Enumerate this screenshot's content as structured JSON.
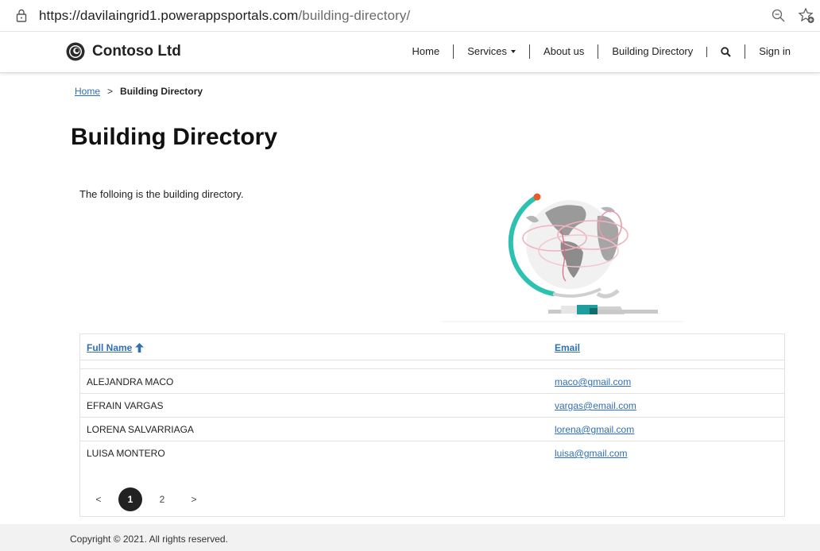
{
  "browser": {
    "url_host": "https://davilaingrid1.powerappsportals.com",
    "url_path": "/building-directory/"
  },
  "header": {
    "brand": "Contoso Ltd",
    "nav": [
      "Home",
      "Services",
      "About us",
      "Building Directory",
      "Sign in"
    ]
  },
  "breadcrumb": {
    "home": "Home",
    "separator": ">",
    "current": "Building Directory"
  },
  "page": {
    "title": "Building Directory",
    "intro": "The folloing is the building directory."
  },
  "table": {
    "columns": [
      "Full Name",
      "Email"
    ],
    "rows": [
      {
        "name": "ALEJANDRA MACO",
        "email": "maco@gmail.com"
      },
      {
        "name": "EFRAIN VARGAS",
        "email": "vargas@email.com"
      },
      {
        "name": "LORENA SALVARRIAGA",
        "email": "lorena@gmail.com"
      },
      {
        "name": "LUISA MONTERO",
        "email": "luisa@gmail.com"
      }
    ]
  },
  "pager": {
    "prev": "<",
    "pages": [
      "1",
      "2"
    ],
    "next": ">",
    "current": "1"
  },
  "footer": {
    "copyright": "Copyright © 2021. All rights reserved."
  },
  "colors": {
    "link": "#2f6fb5",
    "active_page": "#222222",
    "footer_bg": "#f2f2f2"
  },
  "icons": [
    "lock-icon",
    "zoom-out-icon",
    "favorites-add-icon",
    "contoso-logo-icon",
    "search-icon",
    "sort-ascending-icon",
    "globe-illustration"
  ]
}
